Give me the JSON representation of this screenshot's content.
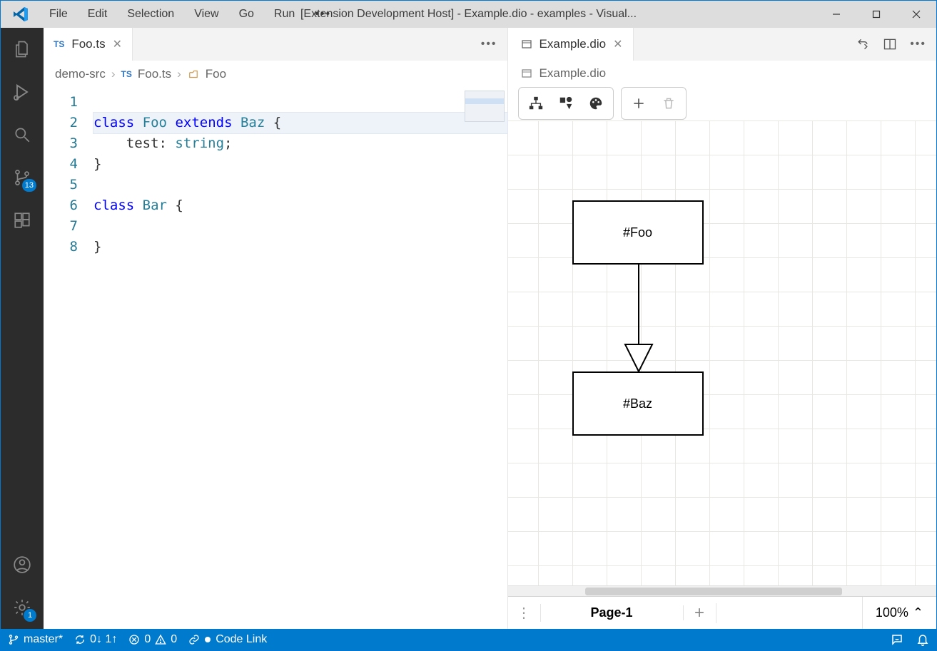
{
  "window": {
    "title": "[Extension Development Host] - Example.dio - examples - Visual..."
  },
  "menu": {
    "file": "File",
    "edit": "Edit",
    "selection": "Selection",
    "view": "View",
    "go": "Go",
    "run": "Run"
  },
  "activitybar": {
    "scm_badge": "13",
    "settings_badge": "1"
  },
  "editor_left": {
    "tab_label": "Foo.ts",
    "tab_lang": "TS",
    "breadcrumb": {
      "root": "demo-src",
      "file_lang": "TS",
      "file": "Foo.ts",
      "symbol": "Foo"
    },
    "lines": [
      "1",
      "2",
      "3",
      "4",
      "5",
      "6",
      "7",
      "8"
    ],
    "code": {
      "l1": "",
      "l2_class": "class",
      "l2_name": "Foo",
      "l2_extends": "extends",
      "l2_base": "Baz",
      "l2_brace": " {",
      "l3_prop": "    test",
      "l3_colon": ": ",
      "l3_type": "string",
      "l3_semi": ";",
      "l4": "}",
      "l5": "",
      "l6_class": "class",
      "l6_name": "Bar",
      "l6_brace": " {",
      "l7": "",
      "l8": "}"
    }
  },
  "editor_right": {
    "tab_label": "Example.dio",
    "breadcrumb_file": "Example.dio",
    "diagram": {
      "node1": "#Foo",
      "node2": "#Baz"
    },
    "page_label": "Page-1",
    "zoom": "100%"
  },
  "statusbar": {
    "branch": "master*",
    "sync": "0↓ 1↑",
    "errors": "0",
    "warnings": "0",
    "codelink": "Code Link"
  }
}
